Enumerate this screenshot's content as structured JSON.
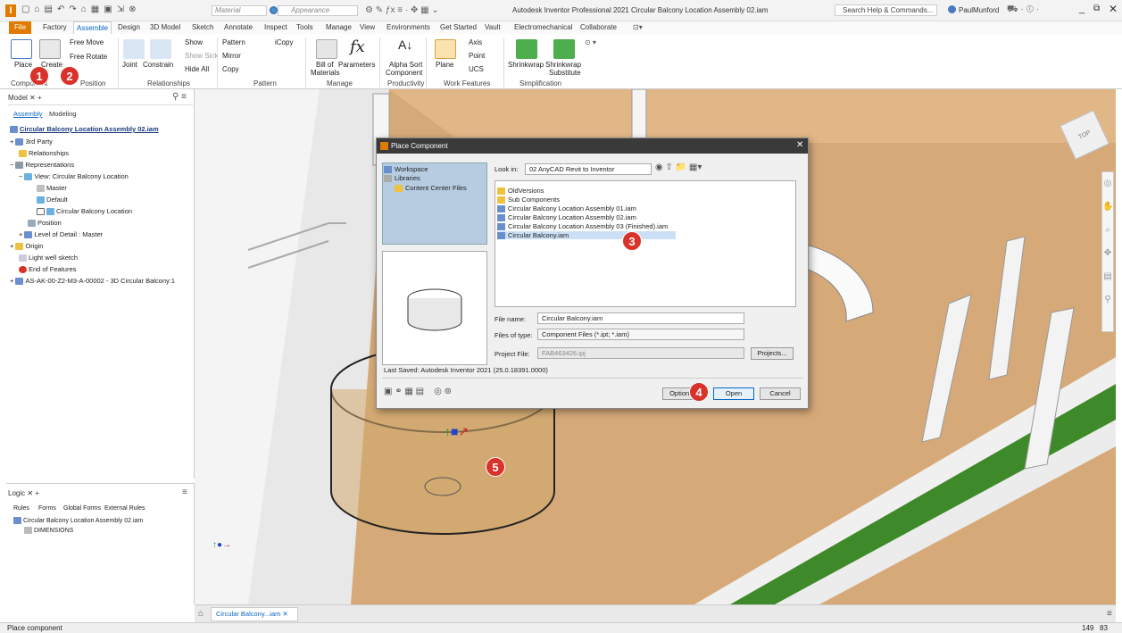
{
  "titlebar": {
    "title": "Autodesk Inventor Professional 2021   Circular Balcony Location Assembly 02.iam",
    "material": "Material",
    "appearance": "Appearance",
    "search": "Search Help & Commands...",
    "user": "PaulMunford"
  },
  "tabs": [
    "File",
    "Factory",
    "Assemble",
    "Design",
    "3D Model",
    "Sketch",
    "Annotate",
    "Inspect",
    "Tools",
    "Manage",
    "View",
    "Environments",
    "Get Started",
    "Vault",
    "Electromechanical",
    "Collaborate"
  ],
  "ribbon": {
    "place": "Place",
    "create": "Create",
    "free_move": "Free Move",
    "free_rotate": "Free Rotate",
    "joint": "Joint",
    "constrain": "Constrain",
    "show": "Show",
    "show_sick": "Show Sick",
    "hide_all": "Hide All",
    "pattern": "Pattern",
    "icopy": "iCopy",
    "mirror": "Mirror",
    "copy": "Copy",
    "bom_1": "Bill of",
    "bom_2": "Materials",
    "parameters": "Parameters",
    "alpha_1": "Alpha Sort",
    "alpha_2": "Component",
    "plane": "Plane",
    "axis": "Axis",
    "point": "Point",
    "ucs": "UCS",
    "shrinkwrap": "Shrinkwrap",
    "shrinkwrap_sub_1": "Shrinkwrap",
    "shrinkwrap_sub_2": "Substitute",
    "g_component": "Component",
    "g_position": "Position",
    "g_relationships": "Relationships",
    "g_pattern": "Pattern",
    "g_manage": "Manage",
    "g_productivity": "Productivity",
    "g_workfeatures": "Work Features",
    "g_simplification": "Simplification"
  },
  "model_panel": {
    "tab": "Model",
    "sub_assembly": "Assembly",
    "sub_modeling": "Modeling",
    "tree": [
      "Circular Balcony Location Assembly 02.iam",
      "3rd Party",
      "Relationships",
      "Representations",
      "View: Circular Balcony Location",
      "Master",
      "Default",
      "Circular Balcony Location",
      "Position",
      "Level of Detail : Master",
      "Origin",
      "Light well sketch",
      "End of Features",
      "AS-AK-00-Z2-M3-A-00002 - 3D Circular Balcony:1"
    ]
  },
  "logic_panel": {
    "tab": "Logic",
    "subtabs": [
      "Rules",
      "Forms",
      "Global Forms",
      "External Rules"
    ],
    "item1": "Circular Balcony Location Assembly 02.iam",
    "item2": "DIMENSIONS"
  },
  "dialog": {
    "title": "Place Component",
    "nav_workspace": "Workspace",
    "nav_libraries": "Libraries",
    "nav_content": "Content Center Files",
    "look_in_label": "Look in:",
    "look_in_value": "02 AnyCAD Revit to Inventor",
    "files": [
      "OldVersions",
      "Sub Components",
      "Circular Balcony Location Assembly 01.iam",
      "Circular Balcony Location Assembly 02.iam",
      "Circular Balcony Location Assembly 03 (Finished).iam",
      "Circular Balcony.iam"
    ],
    "file_name_label": "File name:",
    "file_name_value": "Circular Balcony.iam",
    "files_type_label": "Files of type:",
    "files_type_value": "Component Files (*.ipt; *.iam)",
    "project_label": "Project File:",
    "project_value": "FAB463426.ipj",
    "projects_btn": "Projects...",
    "last_saved": "Last Saved: Autodesk Inventor 2021 (25.0.18391.0000)",
    "options_btn": "Options",
    "open_btn": "Open",
    "cancel_btn": "Cancel"
  },
  "badges": [
    "1",
    "2",
    "3",
    "4",
    "5"
  ],
  "doc_tab": "Circular Balcony...iam",
  "status": {
    "left": "Place component",
    "right_a": "149",
    "right_b": "83"
  },
  "viewcube": "TOP",
  "colors": {
    "accent": "#e07b00",
    "badge": "#d9322b",
    "floor": "#d4a879",
    "dialog_header": "#3a3a3a"
  }
}
